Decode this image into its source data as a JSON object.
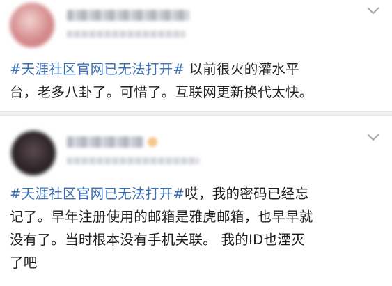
{
  "posts": [
    {
      "topic": "#天涯社区官网已无法打开#",
      "lines": [
        "以前很火的灌水平",
        "台，老多八卦了。可惜了。互联网更新换代太快。"
      ]
    },
    {
      "topic": "#天涯社区官网已无法打开#",
      "lines": [
        "哎，我的密码已经忘",
        "记了。早年注册使用的邮箱是雅虎邮箱，也早早就",
        "没有了。当时根本没有手机关联。 我的ID也湮灭",
        "了吧"
      ]
    }
  ],
  "colors": {
    "topic": "#3a6fb3",
    "text": "#1e1e1e",
    "divider": "#efefef"
  },
  "icons": [
    "avatar",
    "chevron-down-icon"
  ]
}
